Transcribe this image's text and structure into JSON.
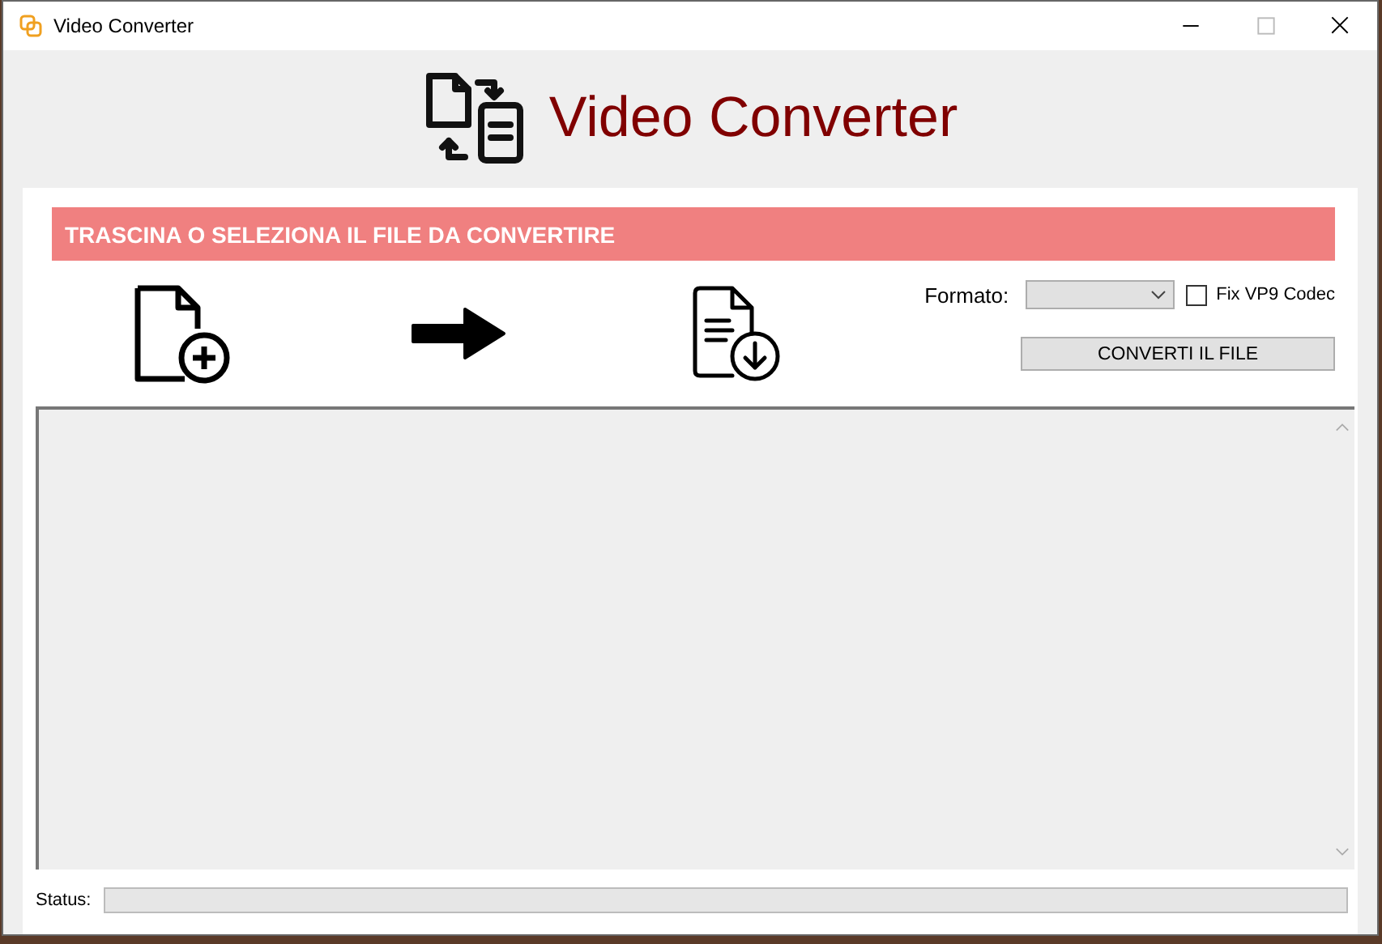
{
  "window": {
    "title": "Video Converter"
  },
  "header": {
    "title": "Video Converter"
  },
  "banner": {
    "text": "TRASCINA O SELEZIONA IL FILE DA CONVERTIRE"
  },
  "options": {
    "format_label": "Formato:",
    "fix_vp9": {
      "label": "Fix VP9 Codec",
      "checked": false
    },
    "convert_button": "CONVERTI IL FILE"
  },
  "status": {
    "label": "Status:",
    "progress": {
      "level": 0
    }
  }
}
